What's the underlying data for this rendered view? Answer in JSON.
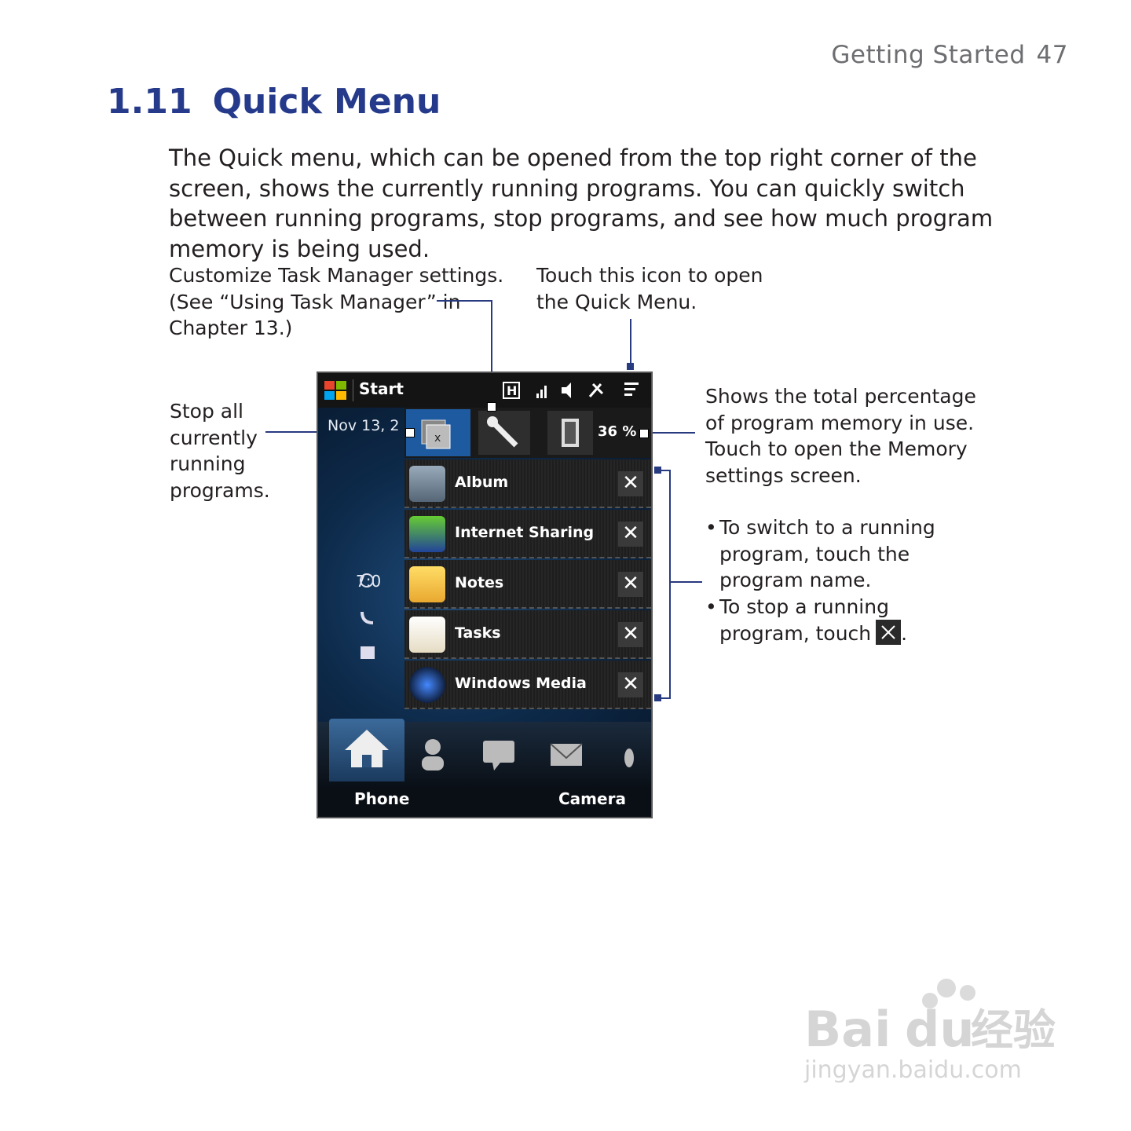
{
  "header": {
    "section": "Getting Started",
    "page": "47"
  },
  "title": {
    "number": "1.11",
    "text": "Quick Menu"
  },
  "intro": "The Quick menu, which can be opened from the top right corner of the screen, shows the currently running programs. You can quickly switch between running programs, stop programs, and see how much program memory is being used.",
  "callouts": {
    "customize": [
      "Customize Task Manager settings.",
      "(See “Using Task Manager” in",
      "Chapter 13.)"
    ],
    "open": [
      "Touch this icon to open",
      "the Quick Menu."
    ],
    "stop_all": [
      "Stop all",
      "currently",
      "running",
      "programs."
    ],
    "memory": [
      "Shows the total percentage",
      "of program memory in use.",
      "Touch to open the Memory",
      "settings screen."
    ],
    "bullets": [
      [
        "To switch to a running",
        "program, touch the",
        "program name."
      ],
      [
        "To stop a running",
        "program, touch"
      ]
    ],
    "bullet_end": "."
  },
  "phone": {
    "start_label": "Start",
    "date_text": "Nov 13, 2",
    "alarm_text": "7:0",
    "memory_percent": "36 %",
    "programs": [
      "Album",
      "Internet Sharing",
      "Notes",
      "Tasks",
      "Windows Media"
    ],
    "close_glyph": "✕",
    "softkeys": {
      "left": "Phone",
      "right": "Camera"
    }
  },
  "watermark": {
    "brand": "Bai",
    "brand2": "du",
    "cn": "经验",
    "url": "jingyan.baidu.com"
  }
}
